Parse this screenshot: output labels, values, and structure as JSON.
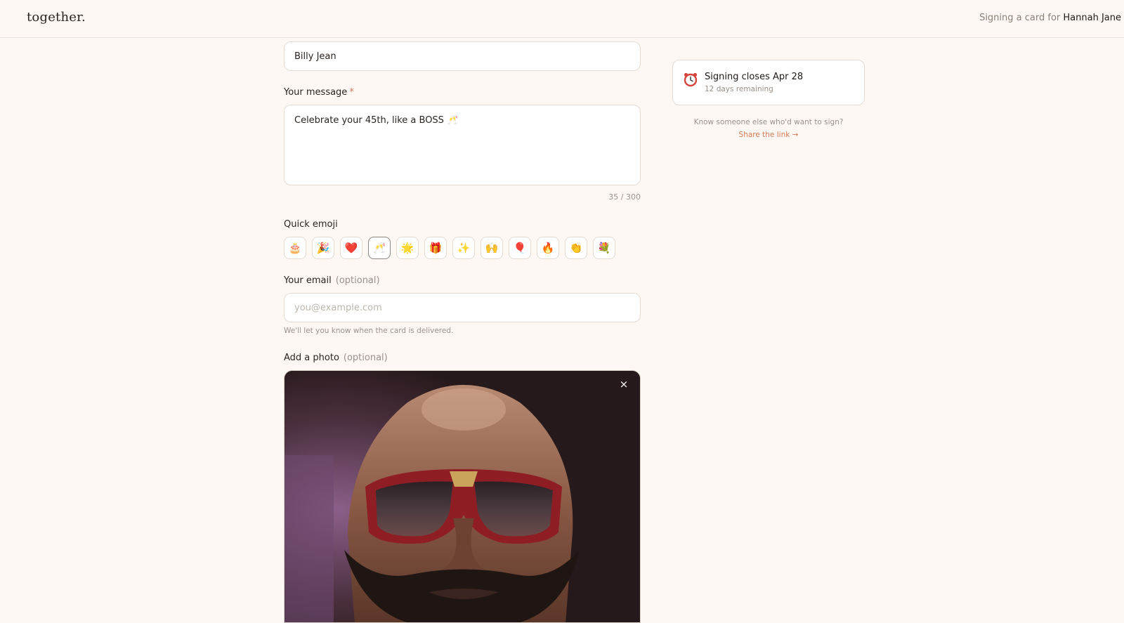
{
  "header": {
    "logo": "together.",
    "signing_prefix": "Signing a card for",
    "recipient": "Hannah Jane"
  },
  "form": {
    "name_value": "Billy Jean",
    "message_label": "Your message",
    "required_mark": "*",
    "message_value": "Celebrate your 45th, like a BOSS 🥂",
    "counter": "35 / 300",
    "emoji_label": "Quick emoji",
    "emojis": [
      "🎂",
      "🎉",
      "❤️",
      "🥂",
      "🌟",
      "🎁",
      "✨",
      "🙌",
      "🎈",
      "🔥",
      "👏",
      "💐"
    ],
    "selected_emoji": "🥂",
    "email_label": "Your email",
    "optional_text": "(optional)",
    "email_placeholder": "you@example.com",
    "email_helper": "We'll let you know when the card is delivered.",
    "photo_label": "Add a photo",
    "photo_close": "×"
  },
  "sidebar": {
    "close_title": "Signing closes Apr 28",
    "days_remaining": "12 days remaining",
    "share_question": "Know someone else who'd want to sign?",
    "share_link": "Share the link →"
  },
  "colors": {
    "background": "#fdf8f3",
    "accent": "#d27a55",
    "required": "#e07a5f",
    "muted_text": "#9a918a",
    "border": "#e4dcd3"
  },
  "icons": {
    "clock": "alarm-clock-icon",
    "close": "close-icon"
  }
}
